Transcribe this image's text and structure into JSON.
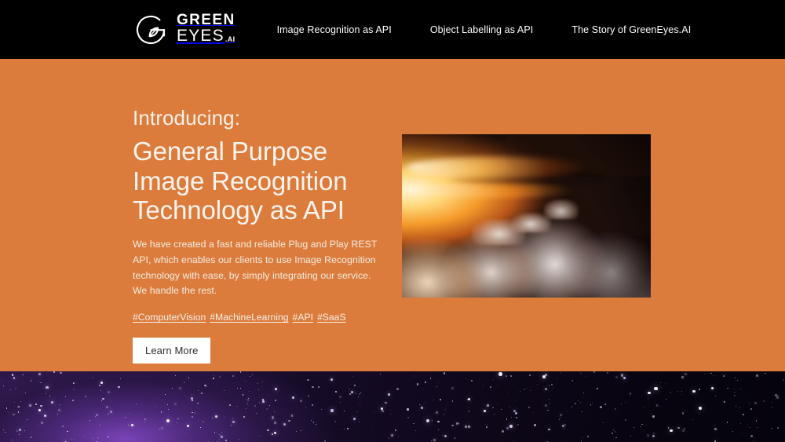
{
  "header": {
    "logo": {
      "icon": "greeneyes-circle-leaf-logo",
      "line1": "GREEN",
      "line2": "EYES",
      "suffix": ".AI"
    },
    "nav": [
      {
        "label": "Image Recognition as API"
      },
      {
        "label": "Object Labelling as API"
      },
      {
        "label": "The Story of GreenEyes.AI"
      }
    ],
    "background": "#000000"
  },
  "hero": {
    "background": "#db7c3c",
    "eyebrow": "Introducing:",
    "headline_lines": [
      "General Purpose",
      "Image Recognition",
      "Technology as API"
    ],
    "paragraph": "We have created a fast and reliable Plug and Play REST API, which enables our clients to use Image Recognition technology with ease, by simply integrating our service. We handle the rest.",
    "tags": [
      {
        "label": "#ComputerVision"
      },
      {
        "label": "#MachineLearning"
      },
      {
        "label": "#API"
      },
      {
        "label": "#SaaS"
      }
    ],
    "cta_label": "Learn More",
    "cta_background": "#ffffff",
    "cta_text_color": "#2e2e2e",
    "image": {
      "name": "sunset-clouds-aerial-photo",
      "description": "Aerial photograph of a golden sunset above a dense cloud bank with a dark storm wedge on the right"
    },
    "text_color": "#f8efe6"
  },
  "bottom_section": {
    "image": {
      "name": "purple-starfield-galaxy-photo",
      "description": "Night sky starfield with a purple nebula glow concentrated on the left side"
    },
    "background": "#140a24"
  }
}
